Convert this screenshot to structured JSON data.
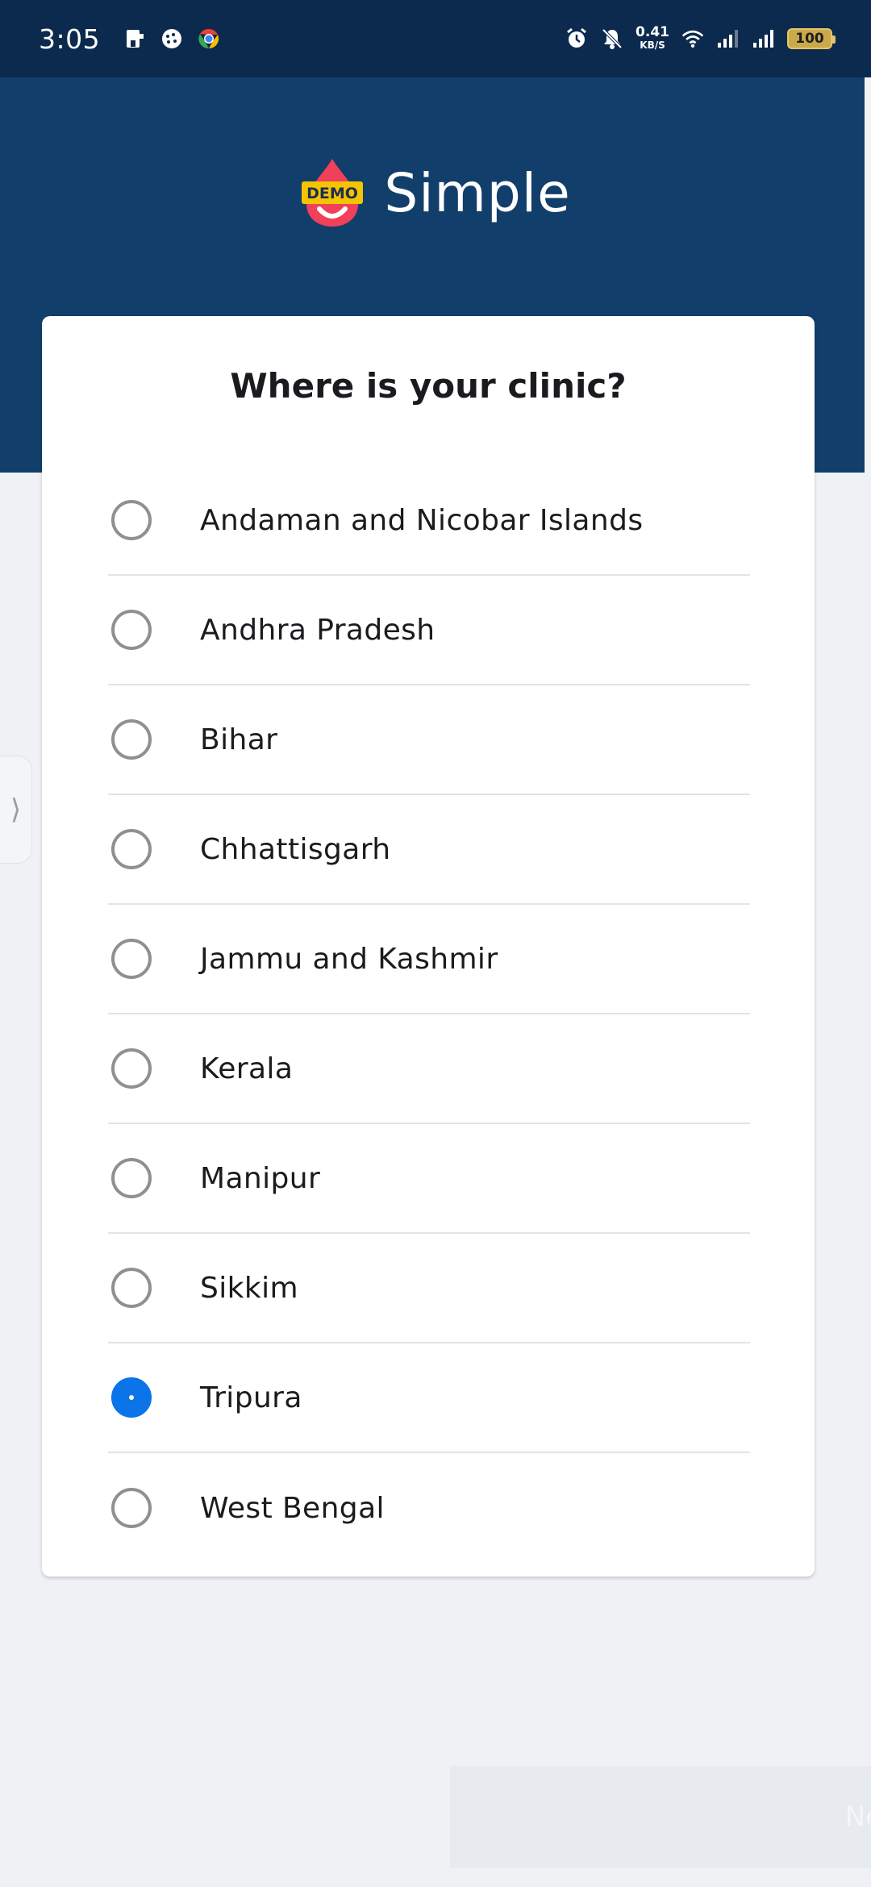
{
  "status_bar": {
    "time": "3:05",
    "net_speed_value": "0.41",
    "net_speed_unit": "KB/S",
    "battery": "100",
    "left_icons": [
      "sim-card-icon",
      "cookie-icon",
      "chrome-icon"
    ],
    "right_icons": [
      "alarm-icon",
      "bell-off-icon",
      "wifi-icon",
      "signal-icon",
      "signal-icon"
    ]
  },
  "header": {
    "logo_badge": "DEMO",
    "app_name": "Simple",
    "background_color": "#123e6b"
  },
  "card": {
    "title": "Where is your clinic?",
    "options": [
      {
        "label": "Andaman and Nicobar Islands",
        "selected": false
      },
      {
        "label": "Andhra Pradesh",
        "selected": false
      },
      {
        "label": "Bihar",
        "selected": false
      },
      {
        "label": "Chhattisgarh",
        "selected": false
      },
      {
        "label": "Jammu and Kashmir",
        "selected": false
      },
      {
        "label": "Kerala",
        "selected": false
      },
      {
        "label": "Manipur",
        "selected": false
      },
      {
        "label": "Sikkim",
        "selected": false
      },
      {
        "label": "Tripura",
        "selected": true
      },
      {
        "label": "West Bengal",
        "selected": false
      }
    ]
  },
  "side_handle": {
    "glyph": "⟩"
  },
  "bottom_button": {
    "label": "Ne"
  },
  "colors": {
    "accent": "#0a74e8",
    "status_bar": "#0b2a4d",
    "page_background": "#eff1f5"
  }
}
